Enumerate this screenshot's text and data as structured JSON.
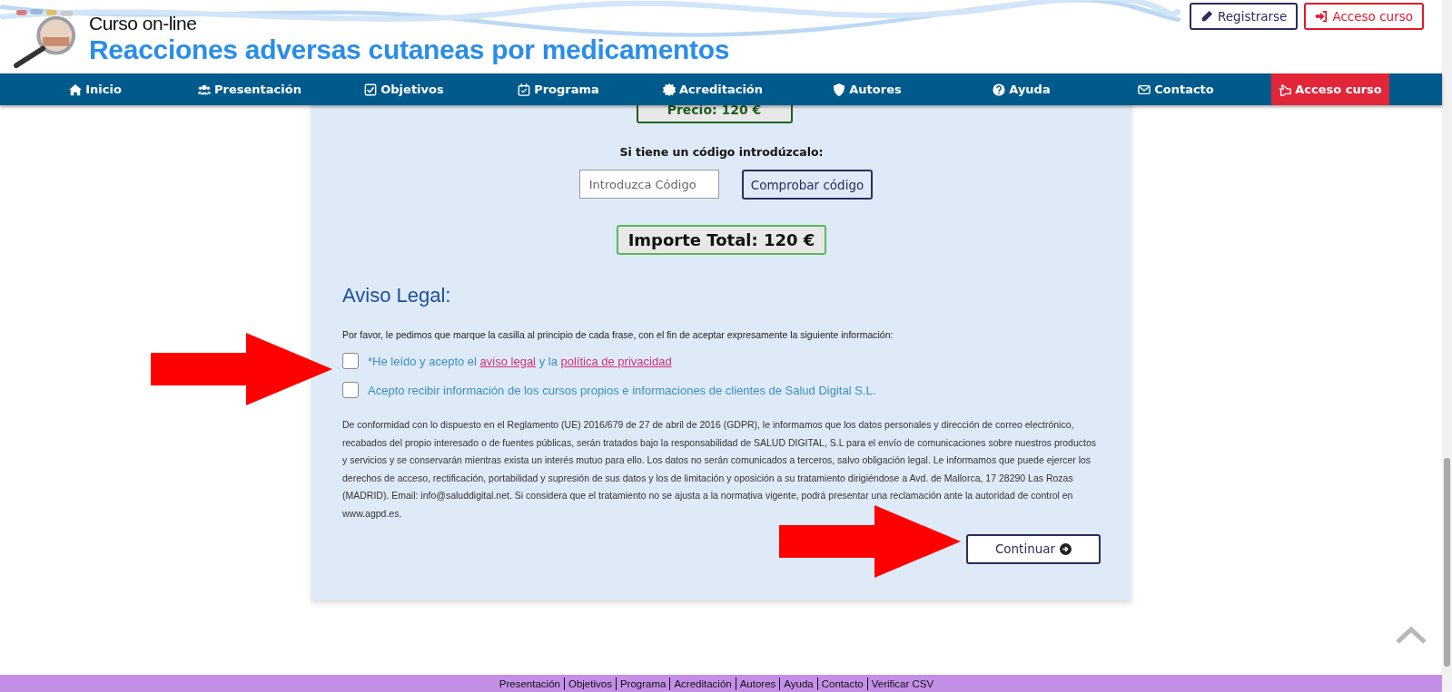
{
  "header": {
    "subtitle": "Curso on-line",
    "title": "Reacciones adversas cutaneas por medicamentos",
    "buttons": [
      {
        "kind": "register",
        "label": "Registrarse"
      },
      {
        "kind": "access",
        "label": "Acceso curso"
      }
    ]
  },
  "nav": [
    {
      "kind": "home",
      "label": "Inicio",
      "highlighted": false
    },
    {
      "kind": "users",
      "label": "Presentación",
      "highlighted": false
    },
    {
      "kind": "check",
      "label": "Objetivos",
      "highlighted": false
    },
    {
      "kind": "calendar",
      "label": "Programa",
      "highlighted": false
    },
    {
      "kind": "badge",
      "label": "Acreditación",
      "highlighted": false
    },
    {
      "kind": "shield",
      "label": "Autores",
      "highlighted": false
    },
    {
      "kind": "question",
      "label": "Ayuda",
      "highlighted": false
    },
    {
      "kind": "envelope",
      "label": "Contacto",
      "highlighted": false
    },
    {
      "kind": "hand",
      "label": "Acceso curso",
      "highlighted": true
    }
  ],
  "price": "Precio: 120 €",
  "code_prompt": "Si tiene un código introdúzcalo:",
  "code_field": {
    "placeholder": "Introduzca Código"
  },
  "code_button": "Comprobar código",
  "total": "Importe Total: 120 €",
  "legal": {
    "heading": "Aviso Legal:",
    "intro": "Por favor, le pedimos que marque la casilla al principio de cada frase, con el fin de aceptar expresamente la siguiente información:",
    "consents": [
      {
        "checked": false,
        "parts": [
          {
            "kind": "text",
            "text": "*He leído y acepto el "
          },
          {
            "kind": "link",
            "text": "aviso legal"
          },
          {
            "kind": "text",
            "text": " y la "
          },
          {
            "kind": "link",
            "text": "política de privacidad"
          }
        ]
      },
      {
        "checked": false,
        "parts": [
          {
            "kind": "text",
            "text": "Acepto recibir información de los cursos propios e informaciones de clientes de Salud Digital S.L."
          }
        ]
      }
    ],
    "notice": "De conformidad con lo dispuesto en el Reglamento (UE) 2016/679 de 27 de abril de 2016 (GDPR), le informamos que los datos personales y dirección de correo electrónico, recabados del propio interesado o de fuentes públicas, serán tratados bajo la responsabilidad de SALUD DIGITAL, S.L para el envío de comunicaciones sobre nuestros productos y servicios y se conservarán mientras exista un interés mutuo para ello. Los datos no serán comunicados a terceros, salvo obligación legal. Le informamos que puede ejercer los derechos de acceso, rectificación, portabilidad y supresión de sus datos y los de limitación y oposición a su tratamiento dirigiéndose a Avd. de Mallorca, 17 28290 Las Rozas (MADRID). Email: info@saluddigital.net. Si considera que el tratamiento no se ajusta a la normativa vigente, podrá presentar una reclamación ante la autoridad de control en www.agpd.es."
  },
  "continue_button": "Continuar",
  "footer": [
    "Presentación",
    "Objetivos",
    "Programa",
    "Acreditación",
    "Autores",
    "Ayuda",
    "Contacto",
    "Verificar CSV"
  ]
}
